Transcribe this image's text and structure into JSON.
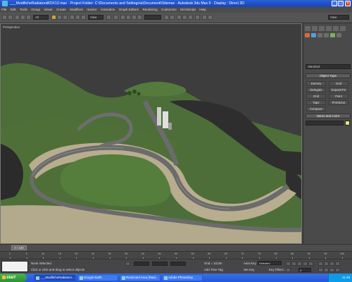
{
  "window": {
    "title": "___ModificheRadiatorsBOX12.max   ·   Project Folder: C:\\Documents and Settings\\a\\Documenti\\3dsmax   ·   Autodesk 3ds Max 9   ·   Display : Direct 3D",
    "controls": {
      "minimize": "_",
      "maximize": "□",
      "close": "×"
    }
  },
  "menu": [
    "File",
    "Edit",
    "Tools",
    "Group",
    "Views",
    "Create",
    "Modifiers",
    "reactor",
    "Animation",
    "Graph Editors",
    "Rendering",
    "Customize",
    "MAXScript",
    "Help"
  ],
  "toolbar": {
    "selection_filter": "All",
    "view_label": "View"
  },
  "viewport": {
    "label": "Perspective"
  },
  "command_panel": {
    "category": "Standard",
    "object_type_title": "Object Type",
    "buttons": [
      "Dummy",
      "Grid",
      "Delegate",
      "ExposeTm",
      "Grid",
      "Point",
      "Tape",
      "Protractor",
      "Compass"
    ],
    "name_color_title": "Name and Color"
  },
  "timeline": {
    "frame_display": "0 / 100",
    "ticks": [
      "0",
      "5",
      "10",
      "15",
      "20",
      "25",
      "30",
      "35",
      "40",
      "45",
      "50",
      "55",
      "60",
      "65",
      "70",
      "75",
      "80",
      "85",
      "90",
      "95",
      "100"
    ]
  },
  "status": {
    "selection": "None Selected",
    "prompt": "Click or click-and-drag to select objects",
    "grid": "Grid = 10,0m",
    "add_time_tag": "Add Time Tag",
    "auto_key": "Auto Key",
    "auto_key_mode": "Selected",
    "set_key": "Set Key",
    "key_filters": "Key Filters...",
    "frame_value": "0"
  },
  "taskbar": {
    "start": "start",
    "items": [
      "___ModificheRadiators...",
      "Google Earth",
      "Restricted Area (Radi...",
      "Adobe Photoshop"
    ],
    "clock": "11:49"
  },
  "colors": {
    "titlebar": "#2a5fd6",
    "viewport_bg": "#3d3d3d",
    "grass": "#4f6f3a",
    "track": "#6b6b6b",
    "sand": "#b8ad8f",
    "accent": "#c9a441"
  }
}
